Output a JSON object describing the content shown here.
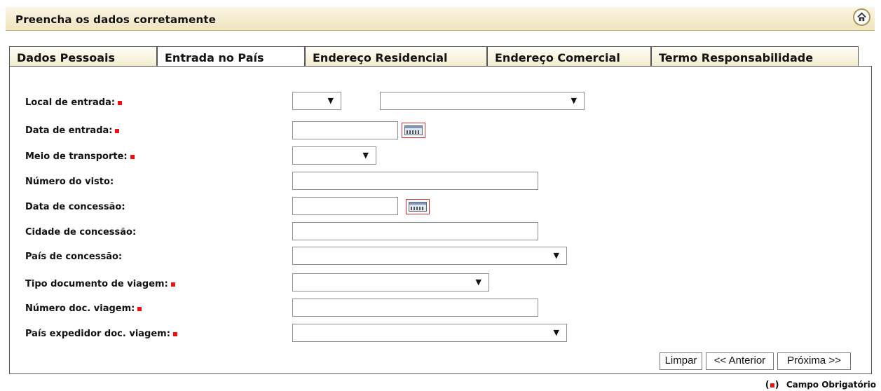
{
  "header": {
    "title": "Preencha os dados corretamente",
    "home_icon": "home-icon"
  },
  "tabs": [
    {
      "label": "Dados Pessoais"
    },
    {
      "label": "Entrada no País"
    },
    {
      "label": "Endereço Residencial"
    },
    {
      "label": "Endereço Comercial"
    },
    {
      "label": "Termo Responsabilidade"
    }
  ],
  "form": {
    "local_entrada": {
      "label": "Local de entrada:",
      "value_a": "",
      "value_b": ""
    },
    "data_entrada": {
      "label": "Data de entrada:",
      "value": ""
    },
    "meio_transporte": {
      "label": "Meio de transporte:",
      "value": ""
    },
    "numero_visto": {
      "label": "Número do visto:",
      "value": ""
    },
    "data_concessao": {
      "label": "Data de concessão:",
      "value": ""
    },
    "cidade_concessao": {
      "label": "Cidade de concessão:",
      "value": ""
    },
    "pais_concessao": {
      "label": "País de concessão:",
      "value": ""
    },
    "tipo_documento": {
      "label": "Tipo documento de viagem:",
      "value": ""
    },
    "numero_doc": {
      "label": "Número doc. viagem:",
      "value": ""
    },
    "pais_expedidor": {
      "label": "País expedidor doc. viagem:",
      "value": ""
    }
  },
  "buttons": {
    "clear": "Limpar",
    "prev": "<< Anterior",
    "next": "Próxima >>"
  },
  "legend": {
    "text": "Campo Obrigatório"
  },
  "colors": {
    "required_marker": "#e11111",
    "header_bg": "#efe4bd"
  },
  "icons": {
    "dropdown": "▼",
    "calendar": "calendar-icon"
  }
}
